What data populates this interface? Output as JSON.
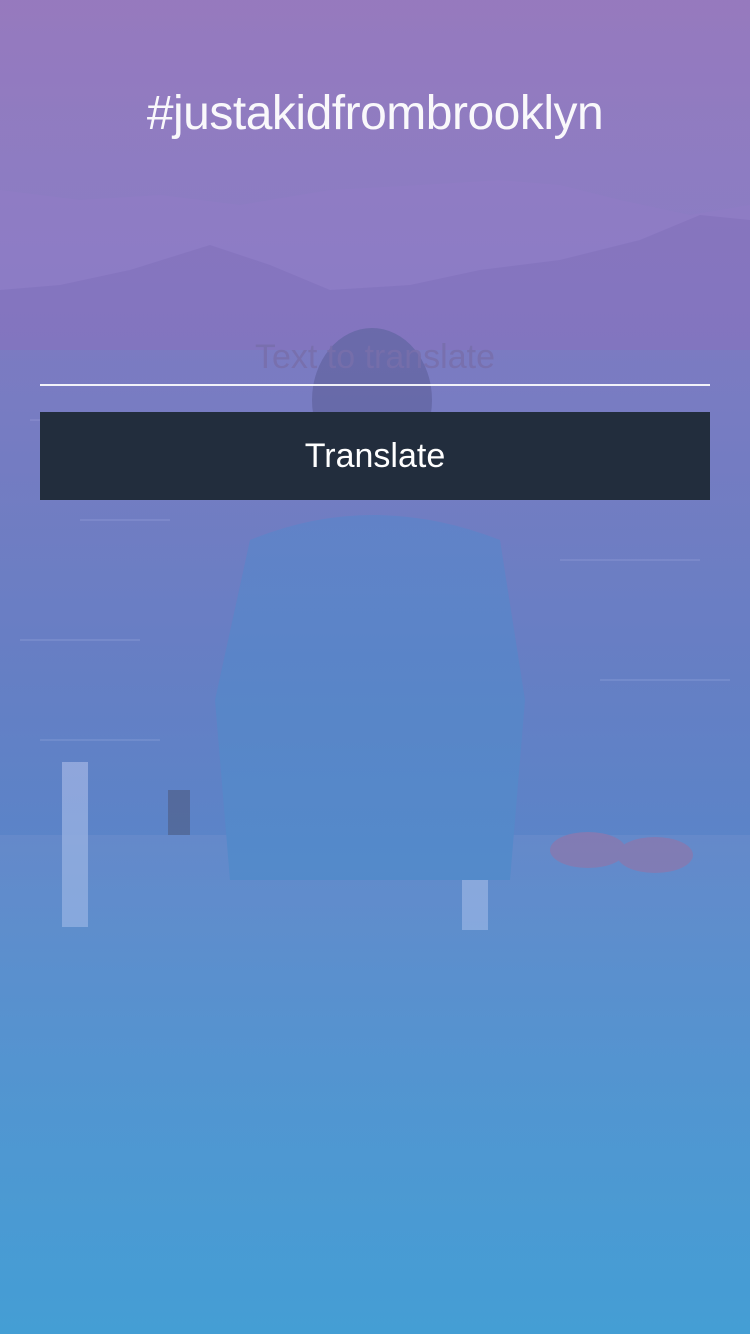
{
  "app": {
    "title": "#justakidfrombrooklyn"
  },
  "form": {
    "input_placeholder": "Text to translate",
    "input_value": "",
    "button_label": "Translate"
  },
  "background": {
    "description_icon": "photo-background",
    "colors": {
      "top_tint": "#a078c3",
      "bottom_tint": "#41a0d7",
      "button": "#222d3d"
    }
  }
}
